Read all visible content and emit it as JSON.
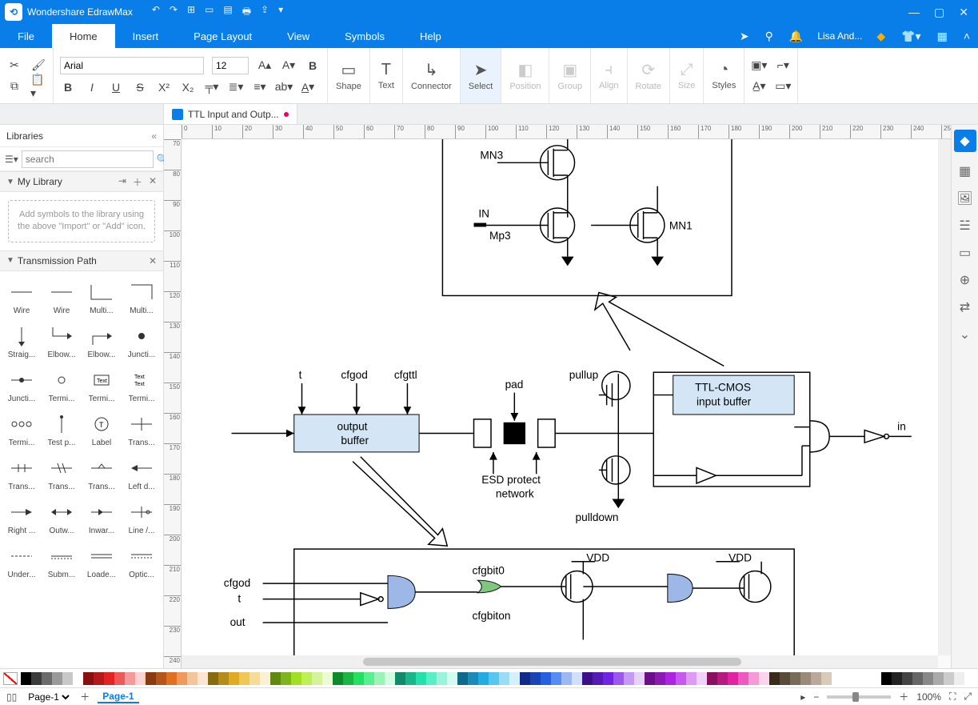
{
  "app": {
    "title": "Wondershare EdrawMax"
  },
  "menu": {
    "items": [
      "File",
      "Home",
      "Insert",
      "Page Layout",
      "View",
      "Symbols",
      "Help"
    ],
    "active": "Home",
    "user": "Lisa And..."
  },
  "ribbon": {
    "font_name": "Arial",
    "font_size": "12",
    "groups": {
      "shape": "Shape",
      "text": "Text",
      "connector": "Connector",
      "select": "Select",
      "position": "Position",
      "group": "Group",
      "align": "Align",
      "rotate": "Rotate",
      "size": "Size",
      "styles": "Styles"
    }
  },
  "left": {
    "title": "Libraries",
    "search_placeholder": "search",
    "mylib": "My Library",
    "hint": "Add symbols to the library using the above \"Import\" or \"Add\" icon.",
    "section": "Transmission Path",
    "symbols": [
      [
        "Wire",
        "Wire",
        "Multi...",
        "Multi..."
      ],
      [
        "Straig...",
        "Elbow...",
        "Elbow...",
        "Juncti..."
      ],
      [
        "Juncti...",
        "Termi...",
        "Termi...",
        "Termi..."
      ],
      [
        "Termi...",
        "Test p...",
        "Label",
        "Trans..."
      ],
      [
        "Trans...",
        "Trans...",
        "Trans...",
        "Left d..."
      ],
      [
        "Right ...",
        "Outw...",
        "Inwar...",
        "Line /..."
      ],
      [
        "Under...",
        "Subm...",
        "Loade...",
        "Optic..."
      ]
    ]
  },
  "doc": {
    "tab": "TTL Input and Outp..."
  },
  "canvas": {
    "labels": {
      "mn3": "MN3",
      "in": "IN",
      "mp3": "Mp3",
      "mn1": "MN1",
      "t": "t",
      "cfgod": "cfgod",
      "cfgttl": "cfgttl",
      "pad": "pad",
      "output_buffer_l1": "output",
      "output_buffer_l2": "buffer",
      "esd1": "ESD protect",
      "esd2": "network",
      "pullup": "pullup",
      "pulldown": "pulldown",
      "ttl1": "TTL-CMOS",
      "ttl2": "input buffer",
      "in_out": "in",
      "cfgbit0": "cfgbit0",
      "cfgbiton": "cfgbiton",
      "vdd": "VDD",
      "cfgod2": "cfgod",
      "t2": "t",
      "out": "out"
    }
  },
  "ruler": {
    "hstart": 0,
    "hstep": 10,
    "hcount": 26,
    "vstart": 70,
    "vstep": 10,
    "vcount": 18
  },
  "colors": [
    "#000000",
    "#3b3b3b",
    "#6b6b6b",
    "#9a9a9a",
    "#c8c8c8",
    "#ffffff",
    "#8a0f0f",
    "#b51a1a",
    "#e02424",
    "#ef5858",
    "#f49a9a",
    "#fbd3d3",
    "#8a3a0f",
    "#b5551a",
    "#e07024",
    "#ef9a58",
    "#f4c49a",
    "#fbe5d3",
    "#8a6a0f",
    "#b58b1a",
    "#e0ab24",
    "#efc758",
    "#f4dc9a",
    "#fbf0d3",
    "#5f8a0f",
    "#7fb51a",
    "#9fe024",
    "#bdef58",
    "#d5f49a",
    "#ecfbd3",
    "#0f8a2a",
    "#1ab545",
    "#24e060",
    "#58ef8c",
    "#9af4b8",
    "#d3fbe0",
    "#0f8a6a",
    "#1ab58b",
    "#24e0ab",
    "#58efc7",
    "#9af4dc",
    "#d3fbf0",
    "#0f6a8a",
    "#1a8bb5",
    "#24abe0",
    "#58c7ef",
    "#9adcf4",
    "#d3f0fb",
    "#0f2a8a",
    "#1a45b5",
    "#2460e0",
    "#588cef",
    "#9ab8f4",
    "#d3e0fb",
    "#3a0f8a",
    "#551ab5",
    "#7024e0",
    "#9a58ef",
    "#c49af4",
    "#e5d3fb",
    "#6a0f8a",
    "#8b1ab5",
    "#ab24e0",
    "#c758ef",
    "#dc9af4",
    "#f0d3fb",
    "#8a0f5f",
    "#b51a7f",
    "#e0249f",
    "#ef58bd",
    "#f49ad5",
    "#fbd3ec",
    "#3a2a1a",
    "#5a4a3a",
    "#7a6a5a",
    "#9a8a7a",
    "#baa99a",
    "#dacaba"
  ],
  "status": {
    "page_select": "Page-1",
    "page_tab": "Page-1",
    "zoom": "100%"
  }
}
